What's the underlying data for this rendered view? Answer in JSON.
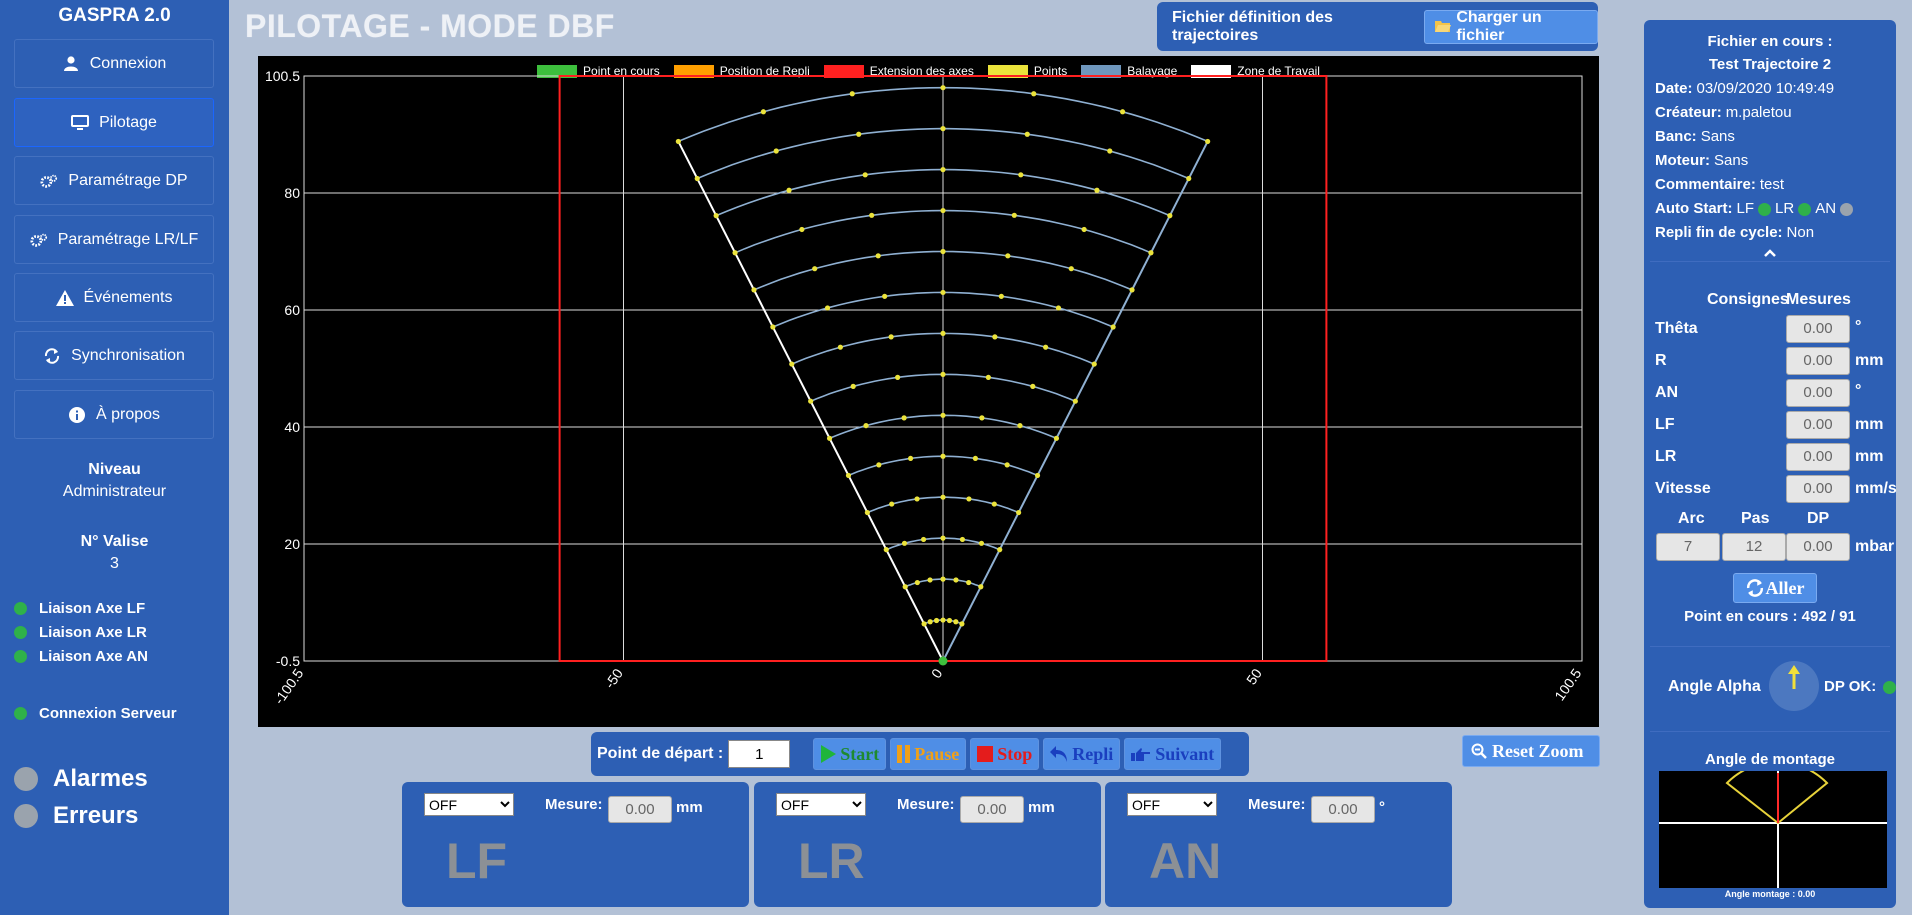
{
  "sidebar": {
    "title": "GASPRA 2.0",
    "items": [
      {
        "label": "Connexion",
        "icon": "user-icon"
      },
      {
        "label": "Pilotage",
        "icon": "monitor-icon"
      },
      {
        "label": "Paramétrage DP",
        "icon": "gears-icon"
      },
      {
        "label": "Paramétrage LR/LF",
        "icon": "gears-icon"
      },
      {
        "label": "Événements",
        "icon": "warning-icon"
      },
      {
        "label": "Synchronisation",
        "icon": "sync-icon"
      },
      {
        "label": "À propos",
        "icon": "info-icon"
      }
    ],
    "niveau_label": "Niveau",
    "niveau_value": "Administrateur",
    "valise_label": "N° Valise",
    "valise_value": "3",
    "links": [
      "Liaison Axe LF",
      "Liaison Axe LR",
      "Liaison Axe AN"
    ],
    "server": "Connexion Serveur",
    "alarmes": "Alarmes",
    "erreurs": "Erreurs"
  },
  "header": {
    "title": "PILOTAGE - MODE DBF",
    "file_def_label": "Fichier définition des trajectoires",
    "load_button": "Charger un fichier"
  },
  "chart_data": {
    "type": "scatter",
    "legend": [
      {
        "label": "Point en cours",
        "color": "#3dbf3d"
      },
      {
        "label": "Position de Repli",
        "color": "#ff9f00"
      },
      {
        "label": "Extension des axes",
        "color": "#ff2020"
      },
      {
        "label": "Points",
        "color": "#ebe33b"
      },
      {
        "label": "Balayage",
        "color": "#6f97bd"
      },
      {
        "label": "Zone de Travail",
        "color": "#ffffff"
      }
    ],
    "xlim": [
      -100,
      100
    ],
    "ylim": [
      0,
      100
    ],
    "x_ticks": [
      "-100.5",
      "-50",
      "0",
      "50",
      "100.5"
    ],
    "y_ticks": [
      "-0.5",
      "20",
      "40",
      "60",
      "80",
      "100.5"
    ],
    "extension_rect": {
      "x": [
        -60,
        60
      ],
      "y": [
        0,
        100
      ]
    },
    "sweep": {
      "half_angle_deg": 25,
      "radii": [
        7,
        14,
        21,
        28,
        35,
        42,
        49,
        56,
        63,
        70,
        77,
        84,
        91,
        98
      ],
      "points_per_arc": 7
    },
    "current_point": {
      "x": 0,
      "y": 0
    }
  },
  "controls": {
    "start_label": "Point de départ :",
    "start_value": "1",
    "start": "Start",
    "pause": "Pause",
    "stop": "Stop",
    "repli": "Repli",
    "suivant": "Suivant",
    "reset_zoom": "Reset Zoom"
  },
  "axes_panels": [
    {
      "mode": "OFF",
      "mesure_label": "Mesure:",
      "value": "0.00",
      "unit": "mm",
      "name": "LF"
    },
    {
      "mode": "OFF",
      "mesure_label": "Mesure:",
      "value": "0.00",
      "unit": "mm",
      "name": "LR"
    },
    {
      "mode": "OFF",
      "mesure_label": "Mesure:",
      "value": "0.00",
      "unit": "°",
      "name": "AN"
    }
  ],
  "right_panel": {
    "file_label": "Fichier en cours :",
    "file_name": "Test Trajectoire 2",
    "date_label": "Date:",
    "date_value": "03/09/2020 10:49:49",
    "createur_label": "Créateur:",
    "createur_value": "m.paletou",
    "banc_label": "Banc:",
    "banc_value": "Sans",
    "moteur_label": "Moteur:",
    "moteur_value": "Sans",
    "commentaire_label": "Commentaire:",
    "commentaire_value": "test",
    "autostart_label": "Auto Start:",
    "autostart_items": [
      "LF",
      "LR",
      "AN"
    ],
    "repli_label": "Repli fin de cycle:",
    "repli_value": "Non",
    "consignes": "Consignes",
    "mesures": "Mesures",
    "rows": [
      {
        "label": "Thêta",
        "value": "0.00",
        "unit": "°"
      },
      {
        "label": "R",
        "value": "0.00",
        "unit": "mm"
      },
      {
        "label": "AN",
        "value": "0.00",
        "unit": "°"
      },
      {
        "label": "LF",
        "value": "0.00",
        "unit": "mm"
      },
      {
        "label": "LR",
        "value": "0.00",
        "unit": "mm"
      },
      {
        "label": "Vitesse",
        "value": "0.00",
        "unit": "mm/s"
      }
    ],
    "arc_label": "Arc",
    "pas_label": "Pas",
    "dp_label": "DP",
    "arc_value": "7",
    "pas_value": "12",
    "dp_value": "0.00",
    "dp_unit": "mbar",
    "aller": "Aller",
    "point_en_cours": "Point en cours : 492 / 91",
    "angle_alpha": "Angle Alpha",
    "dp_ok": "DP OK:",
    "angle_montage_title": "Angle de montage",
    "angle_montage_caption": "Angle montage : 0.00"
  },
  "colors": {
    "panel": "#2d5fb4",
    "background": "#b3c1d6",
    "button": "#4f8ee6"
  }
}
